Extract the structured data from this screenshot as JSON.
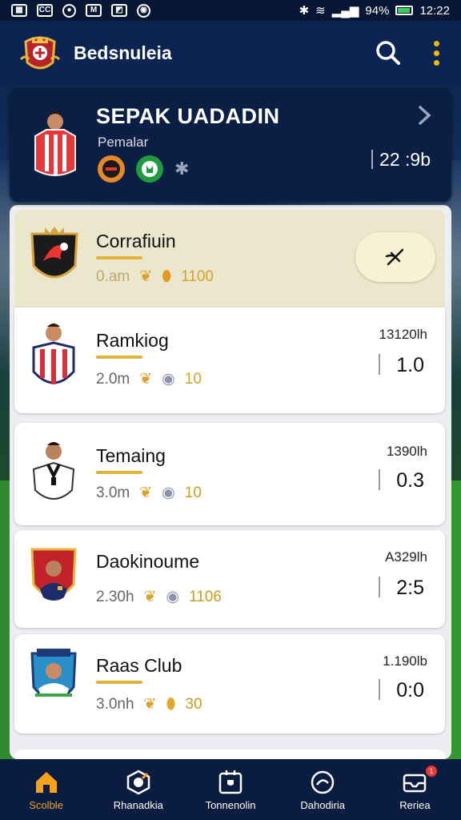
{
  "status_bar": {
    "left_icons": [
      "gallery-icon",
      "cc-icon",
      "record-icon",
      "app-icon",
      "photo-icon",
      "chrome-icon"
    ],
    "battery": "94%",
    "time": "12:22"
  },
  "app_bar": {
    "title": "Bedsnuleia",
    "icons": [
      "crest-icon",
      "search-icon",
      "more-vert-icon"
    ]
  },
  "featured": {
    "title": "SEPAK UADADIN",
    "subtitle": "Pemalar",
    "time": "22 :9b",
    "badge_icons": [
      "club-badge-icon",
      "green-badge-icon",
      "bluetooth-icon"
    ]
  },
  "list": [
    {
      "name": "Corrafiuin",
      "meta": "0.am",
      "value": "1100",
      "time": "",
      "score": "",
      "highlight": true
    },
    {
      "name": "Ramkiog",
      "meta": "2.0m",
      "value": "10",
      "time": "13120lh",
      "score": "1.0",
      "highlight": false
    },
    {
      "name": "Temaing",
      "meta": "3.0m",
      "value": "10",
      "time": "1390lh",
      "score": "0.3",
      "highlight": false
    },
    {
      "name": "Daokinoume",
      "meta": "2.30h",
      "value": "1106",
      "time": "A329lh",
      "score": "2:5",
      "highlight": false
    },
    {
      "name": "Raas Club",
      "meta": "3.0nh",
      "value": "30",
      "time": "1.190lb",
      "score": "0:0",
      "highlight": false
    }
  ],
  "bottom_nav": [
    {
      "label": "Scolble",
      "icon": "home-icon",
      "active": true
    },
    {
      "label": "Rhanadkia",
      "icon": "ball-icon",
      "active": false
    },
    {
      "label": "Tonnenolin",
      "icon": "trophy-board-icon",
      "active": false
    },
    {
      "label": "Dahodiria",
      "icon": "stats-icon",
      "active": false
    },
    {
      "label": "Reriea",
      "icon": "inbox-icon",
      "active": false,
      "badge": "1"
    }
  ],
  "colors": {
    "accent": "#f7a21b",
    "header": "#0c2452",
    "highlight_row": "#ebe7cc",
    "gold": "#d4a22a"
  }
}
